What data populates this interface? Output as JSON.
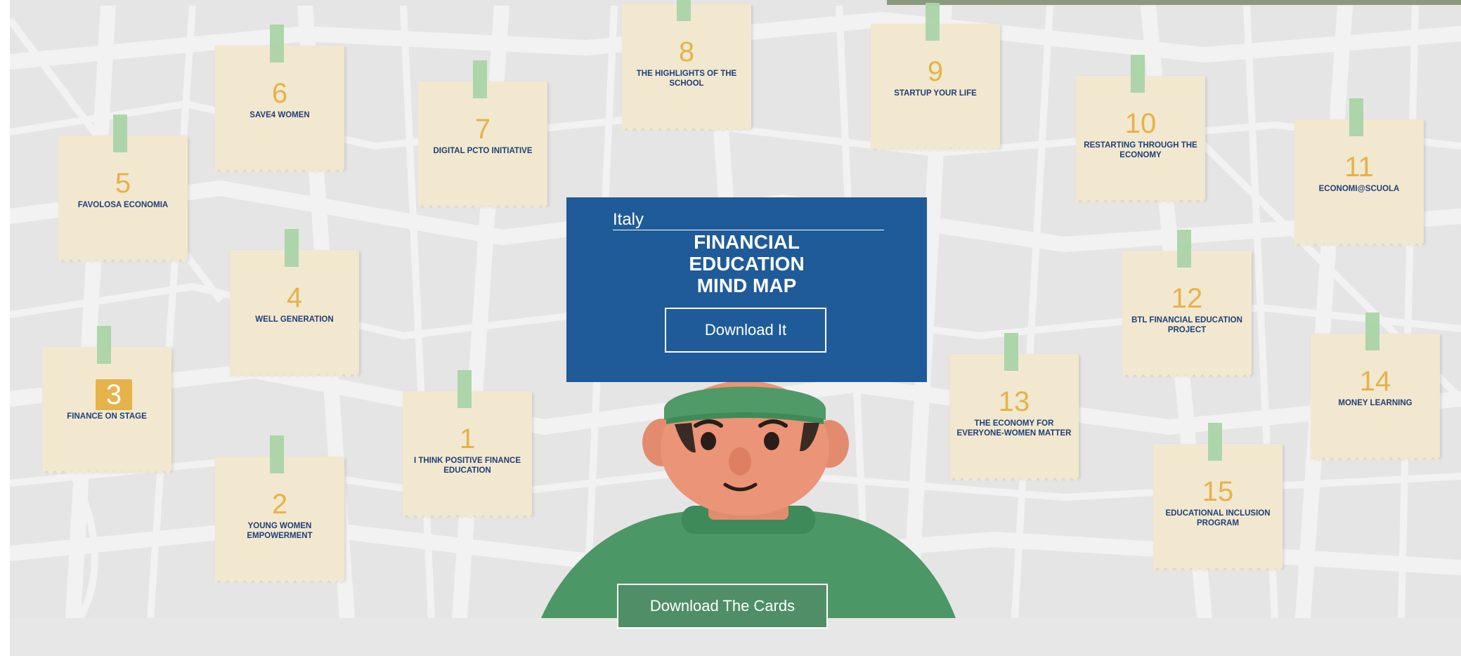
{
  "mindmap": {
    "country": "Italy",
    "title": "FINANCIAL\nEDUCATION\nMIND MAP",
    "download_label": "Download It"
  },
  "cards_button_label": "Download The Cards",
  "colors": {
    "panel_blue": "#1f5b98",
    "card_paper": "#f2e8cf",
    "number_yellow": "#e6b24a",
    "title_navy": "#1e3f78",
    "tape_green": "#a9d4a6",
    "button_green": "#4f8e67"
  },
  "cards": [
    {
      "number": "1",
      "title": "I THINK POSITIVE FINANCE EDUCATION"
    },
    {
      "number": "2",
      "title": "YOUNG WOMEN EMPOWERMENT"
    },
    {
      "number": "3",
      "title": "FINANCE ON STAGE"
    },
    {
      "number": "4",
      "title": "WELL GENERATION"
    },
    {
      "number": "5",
      "title": "FAVOLOSA ECONOMIA"
    },
    {
      "number": "6",
      "title": "SAVE4 WOMEN"
    },
    {
      "number": "7",
      "title": "DIGITAL PCTO INITIATIVE"
    },
    {
      "number": "8",
      "title": "THE HIGHLIGHTS OF THE SCHOOL"
    },
    {
      "number": "9",
      "title": "STARTUP YOUR LIFE"
    },
    {
      "number": "10",
      "title": "RESTARTING THROUGH THE ECONOMY"
    },
    {
      "number": "11",
      "title": "ECONOMI@SCUOLA"
    },
    {
      "number": "12",
      "title": "BTL FINANCIAL EDUCATION PROJECT"
    },
    {
      "number": "13",
      "title": "THE ECONOMY FOR EVERYONE-WOMEN MATTER"
    },
    {
      "number": "14",
      "title": "MONEY LEARNING"
    },
    {
      "number": "15",
      "title": "EDUCATIONAL INCLUSION PROGRAM"
    }
  ]
}
